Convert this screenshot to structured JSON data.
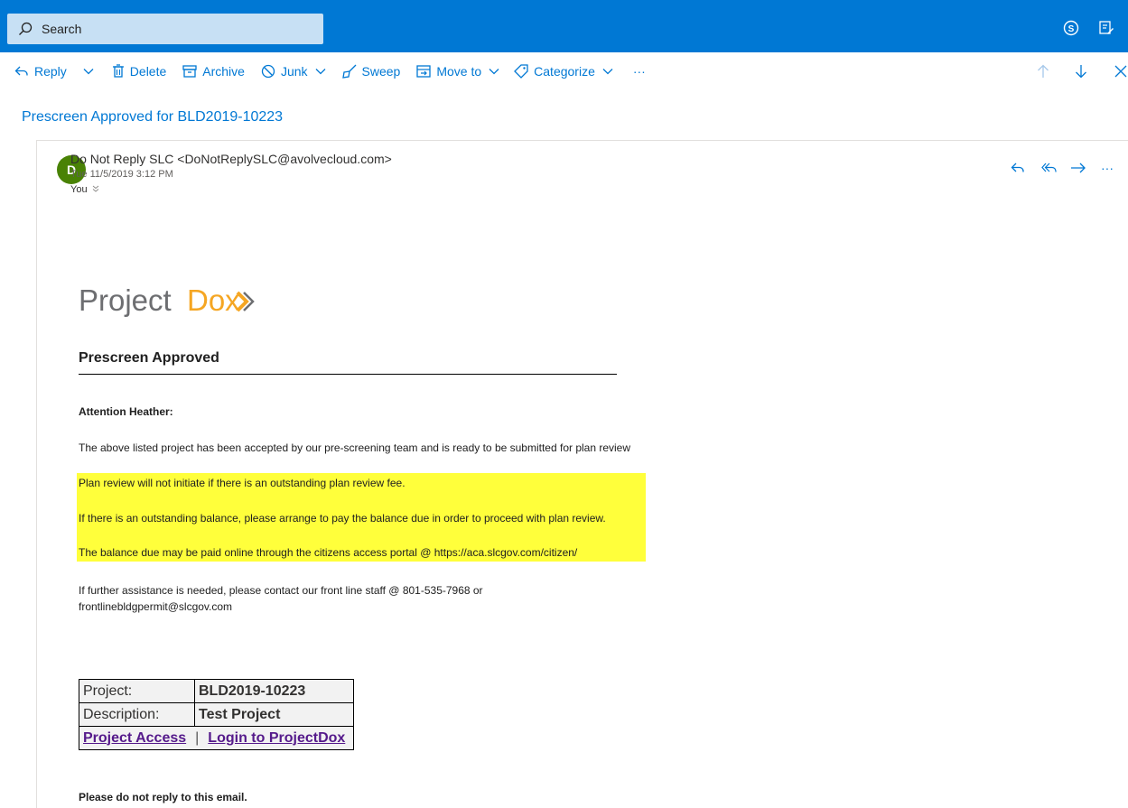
{
  "search": {
    "placeholder": "Search"
  },
  "toolbar": {
    "reply": "Reply",
    "delete": "Delete",
    "archive": "Archive",
    "junk": "Junk",
    "sweep": "Sweep",
    "move_to": "Move to",
    "categorize": "Categorize",
    "more": "···"
  },
  "subject": "Prescreen Approved for BLD2019-10223",
  "message": {
    "avatar_letter": "D",
    "avatar_color": "#498205",
    "sender": "Do Not Reply SLC <DoNotReplySLC@avolvecloud.com>",
    "date": "Tue 11/5/2019 3:12 PM",
    "to": "You"
  },
  "email": {
    "logo_project": "Project",
    "logo_dox": "Dox",
    "heading": "Prescreen Approved",
    "attention": "Attention Heather:",
    "line1": "The above listed project has been accepted by our pre-screening team and is ready to be submitted for plan review",
    "highlight1": "Plan review will not initiate if there is an outstanding plan review fee.",
    "highlight2": "If there is an outstanding balance, please arrange to pay the balance due in order to proceed with plan review.",
    "highlight3": "The balance due may be paid online through the citizens access portal @ https://aca.slcgov.com/citizen/",
    "contact1": "If further assistance is needed, please contact our front line staff @ 801-535-7968 or",
    "contact2": "frontlinebldgpermit@slcgov.com",
    "table": {
      "project_label": "Project:",
      "project_value": "BLD2019-10223",
      "description_label": "Description:",
      "description_value": "Test Project",
      "link1": "Project Access",
      "link_sep": "|",
      "link2": "Login to ProjectDox"
    },
    "footer": "Please do not reply to this email."
  },
  "colors": {
    "brand_blue": "#0078d4",
    "highlight_yellow": "#ffff3b",
    "logo_orange": "#f5a623",
    "logo_gray": "#6d6e71"
  }
}
